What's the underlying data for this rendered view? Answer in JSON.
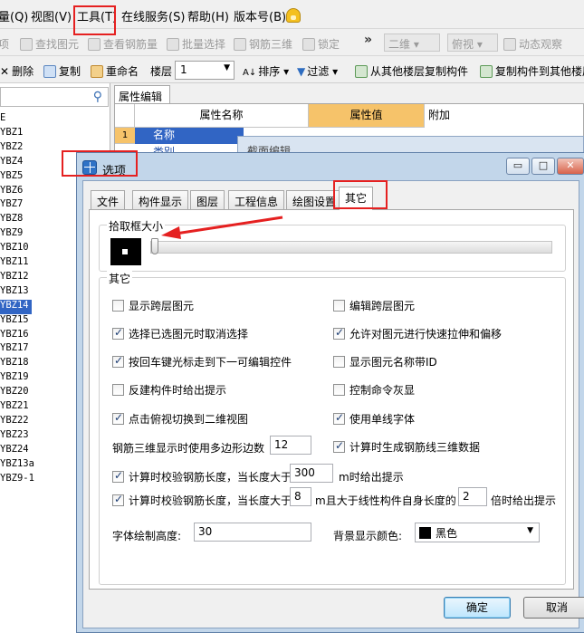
{
  "menubar": {
    "items": [
      {
        "name": "menu-query",
        "label": "量(Q)"
      },
      {
        "name": "menu-view",
        "label": "视图(V)"
      },
      {
        "name": "menu-tools",
        "label": "工具(T)"
      },
      {
        "name": "menu-online-service",
        "label": "在线服务(S)"
      },
      {
        "name": "menu-help",
        "label": "帮助(H)"
      },
      {
        "name": "menu-version",
        "label": "版本号(B)"
      }
    ]
  },
  "toolbar1": {
    "top_fragment": "项",
    "find_element": "查找图元",
    "view_rebar_qty": "查看钢筋量",
    "batch_select": "批量选择",
    "rebar_3d": "钢筋三维",
    "lock": "锁定",
    "more": "»",
    "view_2d": "二维",
    "view_top": "俯视",
    "dynamic_observe": "动态观察"
  },
  "toolbar2": {
    "delete": "删除",
    "copy": "复制",
    "rename": "重命名",
    "floor_label": "楼层",
    "floor_value": "1",
    "sort": "排序",
    "filter": "过滤",
    "copy_from_other_floors": "从其他楼层复制构件",
    "copy_to_other_floors": "复制构件到其他楼层"
  },
  "left_panel": {
    "tree_items": [
      {
        "label": "E",
        "selected": false
      },
      {
        "label": "YBZ1",
        "selected": false
      },
      {
        "label": "YBZ2",
        "selected": false
      },
      {
        "label": "YBZ4",
        "selected": false
      },
      {
        "label": "YBZ5",
        "selected": false
      },
      {
        "label": "YBZ6",
        "selected": false
      },
      {
        "label": "YBZ7",
        "selected": false
      },
      {
        "label": "YBZ8",
        "selected": false
      },
      {
        "label": "YBZ9",
        "selected": false
      },
      {
        "label": "YBZ10",
        "selected": false
      },
      {
        "label": "YBZ11",
        "selected": false
      },
      {
        "label": "YBZ12",
        "selected": false
      },
      {
        "label": "YBZ13",
        "selected": false
      },
      {
        "label": "YBZ14",
        "selected": true
      },
      {
        "label": "YBZ15",
        "selected": false
      },
      {
        "label": "YBZ16",
        "selected": false
      },
      {
        "label": "YBZ17",
        "selected": false
      },
      {
        "label": "YBZ18",
        "selected": false
      },
      {
        "label": "YBZ19",
        "selected": false
      },
      {
        "label": "YBZ20",
        "selected": false
      },
      {
        "label": "YBZ21",
        "selected": false
      },
      {
        "label": "YBZ22",
        "selected": false
      },
      {
        "label": "YBZ23",
        "selected": false
      },
      {
        "label": "YBZ24",
        "selected": false
      },
      {
        "label": "YBZ13a",
        "selected": false
      },
      {
        "label": "YBZ9-1",
        "selected": false
      }
    ]
  },
  "property_panel": {
    "tab": "属性编辑",
    "columns": {
      "name": "属性名称",
      "value": "属性值",
      "extra": "附加"
    },
    "row1": {
      "num": "1",
      "name": "名称"
    },
    "row2": {
      "name": "类别"
    }
  },
  "section_dialog": {
    "title": "截面编辑"
  },
  "options_dialog": {
    "title": "选项",
    "window_buttons": {
      "minimize": "▭",
      "maximize": "□",
      "close": "✕"
    },
    "tabs": [
      {
        "label": "文件",
        "active": false
      },
      {
        "label": "构件显示",
        "active": false
      },
      {
        "label": "图层",
        "active": false
      },
      {
        "label": "工程信息",
        "active": false
      },
      {
        "label": "绘图设置",
        "active": false
      },
      {
        "label": "其它",
        "active": true
      }
    ],
    "pick_box": {
      "label": "拾取框大小",
      "level": 0
    },
    "other_group": {
      "label": "其它",
      "checkboxes": [
        {
          "label": "显示跨层图元",
          "checked": false
        },
        {
          "label": "编辑跨层图元",
          "checked": false
        },
        {
          "label": "选择已选图元时取消选择",
          "checked": true
        },
        {
          "label": "允许对图元进行快速拉伸和偏移",
          "checked": true
        },
        {
          "label": "按回车键光标走到下一可编辑控件",
          "checked": true
        },
        {
          "label": "显示图元名称带ID",
          "checked": false
        },
        {
          "label": "反建构件时给出提示",
          "checked": false
        },
        {
          "label": "控制命令灰显",
          "checked": false
        },
        {
          "label": "点击俯视切换到二维视图",
          "checked": true
        },
        {
          "label": "使用单线字体",
          "checked": true
        }
      ],
      "polygon_sides": {
        "label": "钢筋三维显示时使用多边形边数",
        "value": "12"
      },
      "gen_rebar_3d": {
        "label": "计算时生成钢筋线三维数据",
        "checked": true
      },
      "check_len_1": {
        "label": "计算时校验钢筋长度，当长度大于",
        "value": "300",
        "suffix": "m时给出提示",
        "checked": true
      },
      "check_len_2": {
        "label": "计算时校验钢筋长度，当长度大于",
        "value": "8",
        "middle": "m且大于线性构件自身长度的",
        "value2": "2",
        "suffix": "倍时给出提示",
        "checked": true
      },
      "font_height": {
        "label": "字体绘制高度:",
        "value": "30"
      },
      "bg_color": {
        "label": "背景显示颜色:",
        "value": "黑色",
        "swatch": "#000000"
      }
    },
    "buttons": {
      "ok": "确定",
      "cancel": "取消"
    }
  },
  "colors": {
    "highlight": "#e52020",
    "selection": "#3165c4",
    "header_accent": "#f6c36a"
  }
}
